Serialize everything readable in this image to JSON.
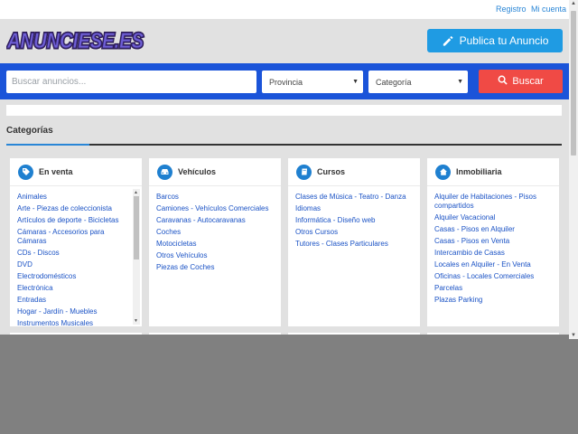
{
  "top_links": {
    "register": "Registro",
    "account": "Mi cuenta"
  },
  "logo_text": "ANUNCIESE.ES",
  "publish_label": "Publica tu Anuncio",
  "search": {
    "placeholder": "Buscar anuncios...",
    "province": "Provincia",
    "category": "Categoría",
    "button": "Buscar"
  },
  "section_title": "Categorías",
  "colors": {
    "brand_blue": "#1b54d9",
    "accent_blue": "#1f9be3",
    "search_red": "#f04a45",
    "link": "#1a52c5"
  },
  "cards": [
    {
      "title": "En venta",
      "icon": "tag-icon",
      "items": [
        "Animales",
        "Arte - Piezas de coleccionista",
        "Artículos de deporte - Bicicletas",
        "Cámaras - Accesorios para Cámaras",
        "CDs - Discos",
        "DVD",
        "Electrodomésticos",
        "Electrónica",
        "Entradas",
        "Hogar - Jardín - Muebles",
        "Instrumentos Musicales"
      ]
    },
    {
      "title": "Vehículos",
      "icon": "car-icon",
      "items": [
        "Barcos",
        "Camiones - Vehículos Comerciales",
        "Caravanas - Autocaravanas",
        "Coches",
        "Motocicletas",
        "Otros Vehículos",
        "Piezas de Coches"
      ]
    },
    {
      "title": "Cursos",
      "icon": "book-icon",
      "items": [
        "Clases de Música - Teatro - Danza",
        "Idiomas",
        "Informática - Diseño web",
        "Otros Cursos",
        "Tutores - Clases Particulares"
      ]
    },
    {
      "title": "Inmobiliaria",
      "icon": "home-icon",
      "items": [
        "Alquiler de Habitaciones - Pisos compartidos",
        "Alquiler Vacacional",
        "Casas - Pisos en Alquiler",
        "Casas - Pisos en Venta",
        "Intercambio de Casas",
        "Locales en Alquiler - En Venta",
        "Oficinas - Locales Comerciales",
        "Parcelas",
        "Plazas Parking"
      ]
    }
  ]
}
